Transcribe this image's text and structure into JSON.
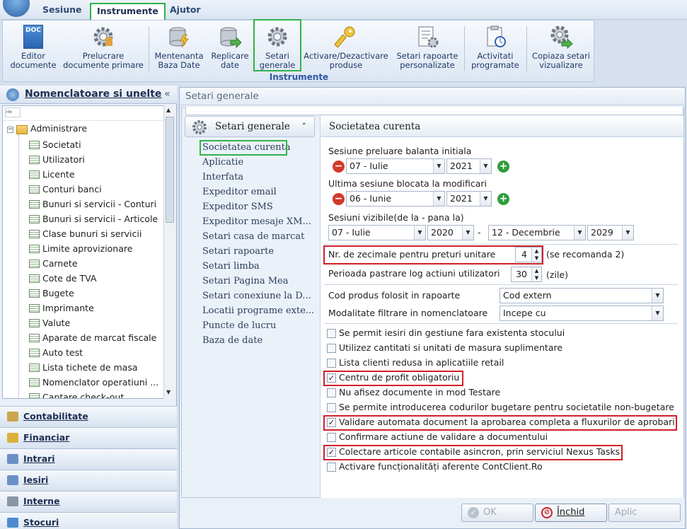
{
  "menu": {
    "tabs": [
      {
        "label": "Sesiune"
      },
      {
        "label": "Instrumente"
      },
      {
        "label": "Ajutor"
      }
    ]
  },
  "ribbon": {
    "group_label": "Instrumente",
    "buttons": [
      {
        "line1": "Editor",
        "line2": "documente",
        "icon": "doc-icon"
      },
      {
        "line1": "Prelucrare",
        "line2": "documente primare",
        "icon": "gear-icon"
      },
      {
        "line1": "Mentenanta",
        "line2": "Baza Date",
        "icon": "database-lightning-icon"
      },
      {
        "line1": "Replicare",
        "line2": "date",
        "icon": "database-arrow-icon"
      },
      {
        "line1": "Setari",
        "line2": "generale",
        "icon": "gear-icon"
      },
      {
        "line1": "Activare/Dezactivare",
        "line2": "produse",
        "icon": "key-icon"
      },
      {
        "line1": "Setari rapoarte",
        "line2": "personalizate",
        "icon": "report-gear-icon"
      },
      {
        "line1": "Activitati",
        "line2": "programate",
        "icon": "scheduled-task-icon"
      },
      {
        "line1": "Copiaza setari",
        "line2": "vizualizare",
        "icon": "gear-copy-icon"
      }
    ]
  },
  "nav": {
    "title": "Nomenclatoare si unelte",
    "collapse": "«",
    "tree_root": "Administrare",
    "tree_items": [
      "Societati",
      "Utilizatori",
      "Licente",
      "Conturi banci",
      "Bunuri si servicii - Conturi",
      "Bunuri si servicii - Articole",
      "Clase bunuri si servicii",
      "Limite aprovizionare",
      "Carnete",
      "Cote de TVA",
      "Bugete",
      "Imprimante",
      "Valute",
      "Aparate de marcat fiscale",
      "Auto test",
      "Lista tichete de masa",
      "Nomenclator operatiuni ...",
      "Captare check-out"
    ],
    "sections": [
      "Contabilitate",
      "Financiar",
      "Intrari",
      "Iesiri",
      "Interne",
      "Stocuri"
    ]
  },
  "main": {
    "title": "Setari generale",
    "side_header": "Setari generale",
    "side_links": [
      "Societatea curenta",
      "Aplicatie",
      "Interfata",
      "Expeditor email",
      "Expeditor SMS",
      "Expeditor mesaje XM...",
      "Setari casa de marcat",
      "Setari rapoarte",
      "Setari limba",
      "Setari Pagina Mea",
      "Setari conexiune la D...",
      "Locatii programe exte...",
      "Puncte de lucru",
      "Baza de date"
    ],
    "content_header": "Societatea curenta",
    "sesiune_label": "Sesiune preluare balanta initiala",
    "sesiune_month": "07 - Iulie",
    "sesiune_year": "2021",
    "blocata_label": "Ultima sesiune blocata la modificari",
    "blocata_month": "06 - Iunie",
    "blocata_year": "2021",
    "vizibile_label": "Sesiuni vizibile(de la - pana la)",
    "viz_from_month": "07 - Iulie",
    "viz_from_year": "2020",
    "viz_dash": "-",
    "viz_to_month": "12 - Decembrie",
    "viz_to_year": "2029",
    "zecimale_label": "Nr. de zecimale pentru preturi unitare",
    "zecimale_value": "4",
    "zecimale_note": "(se recomanda 2)",
    "log_label": "Perioada pastrare log actiuni utilizatori",
    "log_value": "30",
    "log_note": "(zile)",
    "cod_label": "Cod produs folosit in rapoarte",
    "cod_value": "Cod extern",
    "filtrare_label": "Modalitate filtrare in nomenclatoare",
    "filtrare_value": "Incepe cu",
    "checkboxes": [
      {
        "label": "Se permit iesiri din gestiune fara existenta stocului",
        "checked": false
      },
      {
        "label": "Utilizez cantitati si unitati de masura suplimentare",
        "checked": false
      },
      {
        "label": "Lista clienti redusa in aplicatiile retail",
        "checked": false
      },
      {
        "label": "Centru de profit obligatoriu",
        "checked": true
      },
      {
        "label": "Nu afisez documente in mod Testare",
        "checked": false
      },
      {
        "label": "Se permite introducerea codurilor bugetare pentru societatile non-bugetare",
        "checked": false
      },
      {
        "label": "Validare automata document la aprobarea completa a fluxurilor de aprobari",
        "checked": true
      },
      {
        "label": "Confirmare actiune de validare a documentului",
        "checked": false
      },
      {
        "label": "Colectare articole contabile asincron, prin serviciul Nexus Tasks",
        "checked": true
      },
      {
        "label": "Activare funcționalități aferente ContClient.Ro",
        "checked": false
      }
    ],
    "btn_ok": "OK",
    "btn_cancel": "Închid",
    "btn_apply": "Aplic"
  },
  "colors": {
    "highlight_green": "#2fb34a",
    "highlight_red": "#d0202a",
    "accent": "#2e57a0"
  }
}
